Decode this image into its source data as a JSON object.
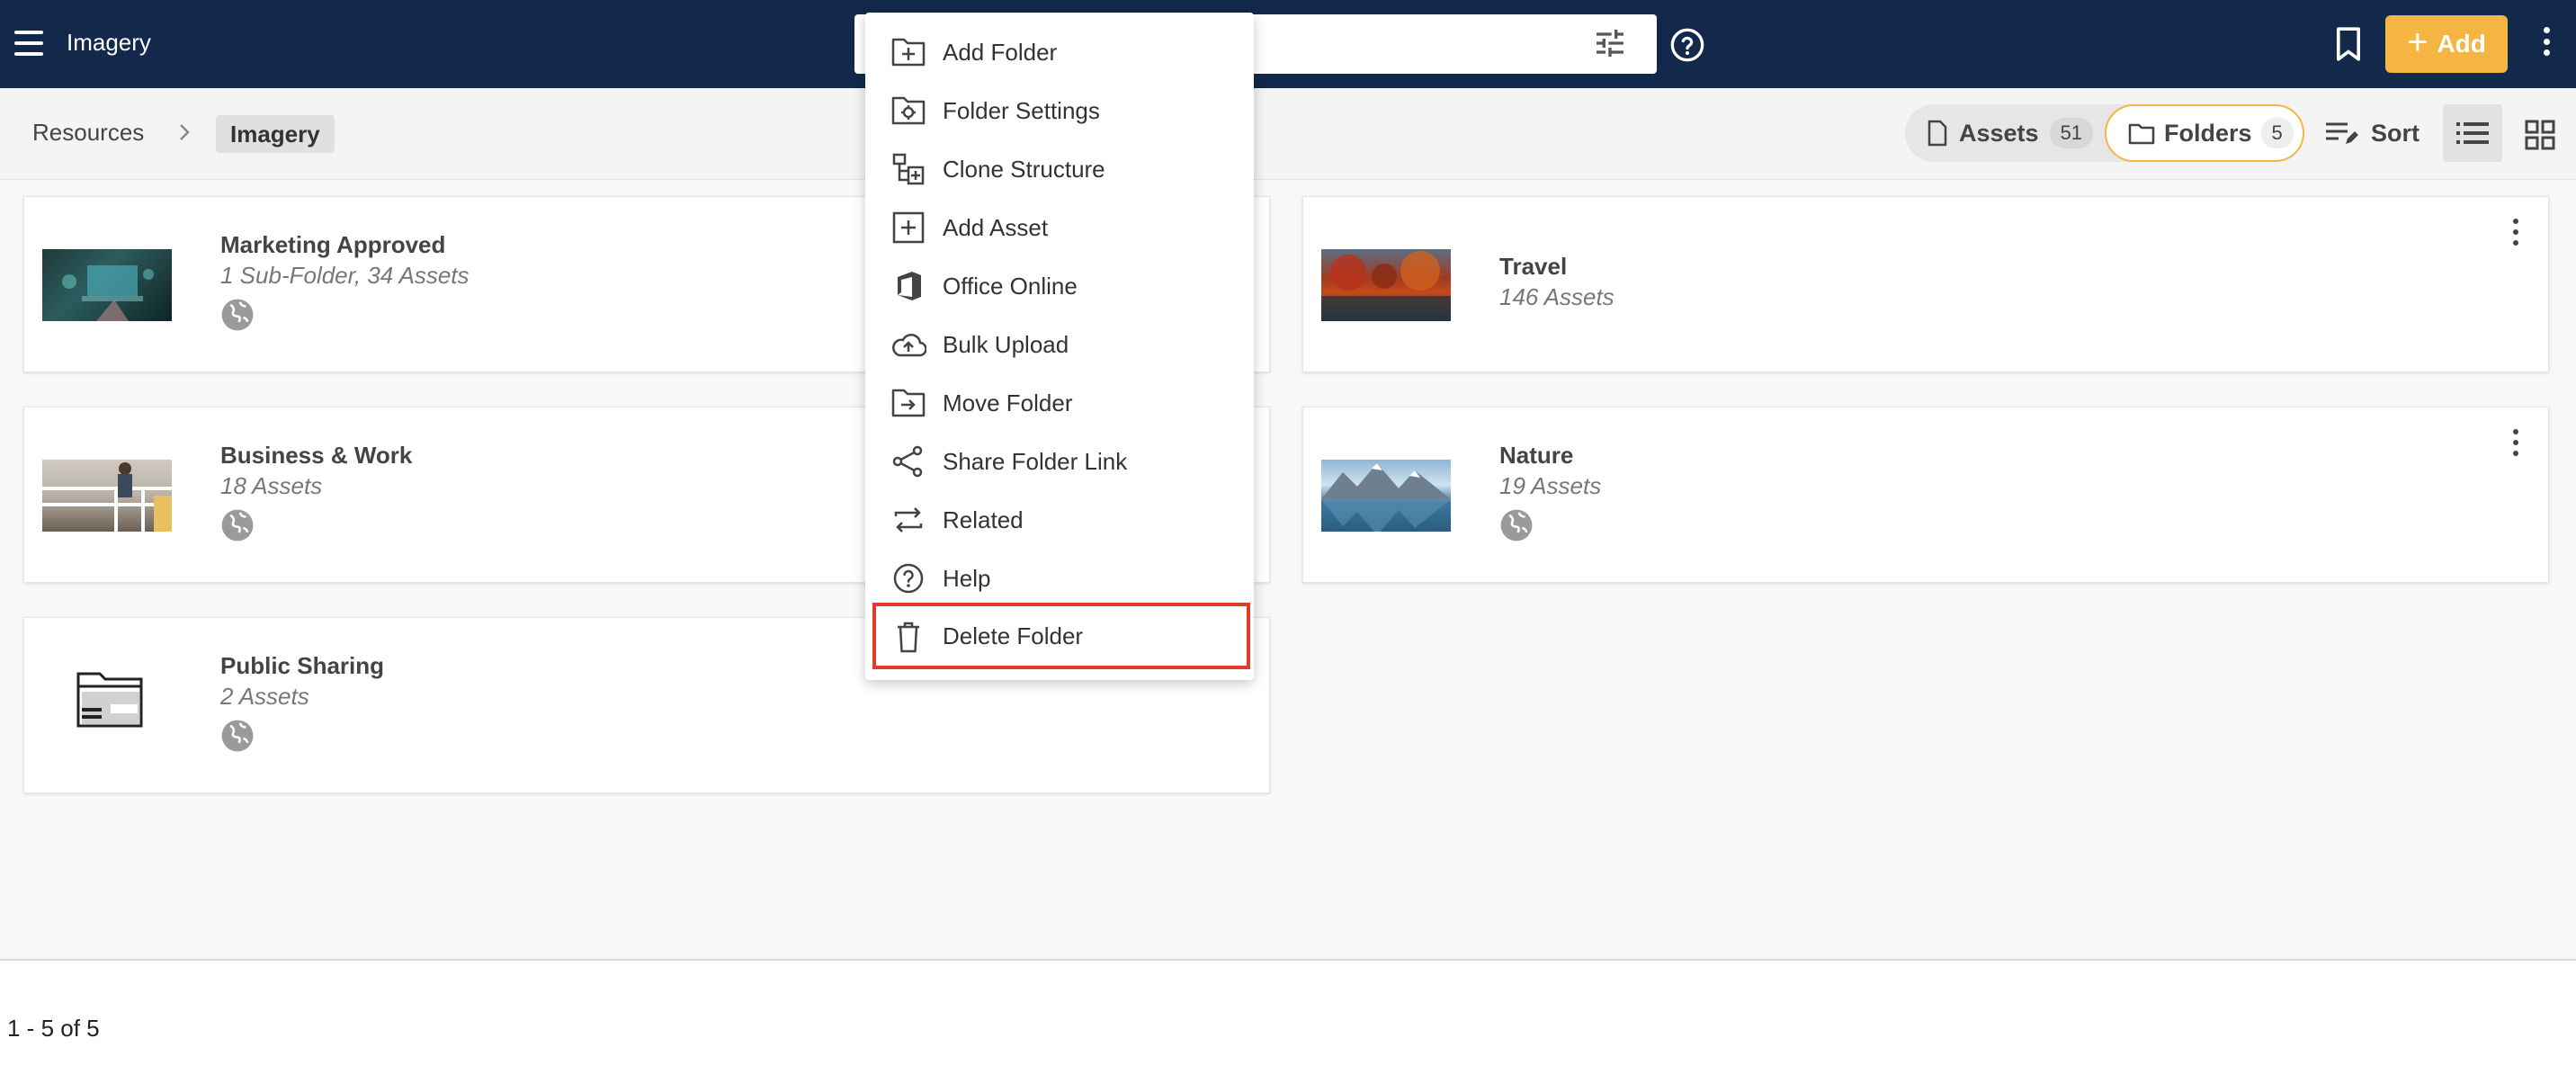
{
  "header": {
    "app_title": "Imagery",
    "add_label": "Add",
    "accent": "#f5b543",
    "bg": "#13294b"
  },
  "breadcrumb": {
    "root": "Resources",
    "current": "Imagery"
  },
  "toolbar": {
    "assets_label": "Assets",
    "assets_count": "51",
    "folders_label": "Folders",
    "folders_count": "5",
    "sort_label": "Sort"
  },
  "folders": [
    {
      "name": "Marketing Approved",
      "meta": "1 Sub-Folder, 34 Assets"
    },
    {
      "name": "Travel",
      "meta": "146 Assets"
    },
    {
      "name": "Business & Work",
      "meta": "18 Assets"
    },
    {
      "name": "Nature",
      "meta": "19 Assets"
    },
    {
      "name": "Public Sharing",
      "meta": "2 Assets"
    }
  ],
  "menu": {
    "items": [
      {
        "label": "Add Folder",
        "icon": "folder-plus-icon"
      },
      {
        "label": "Folder Settings",
        "icon": "folder-settings-icon"
      },
      {
        "label": "Clone Structure",
        "icon": "clone-structure-icon"
      },
      {
        "label": "Add Asset",
        "icon": "add-box-icon"
      },
      {
        "label": "Office Online",
        "icon": "office-icon"
      },
      {
        "label": "Bulk Upload",
        "icon": "cloud-upload-icon"
      },
      {
        "label": "Move Folder",
        "icon": "folder-move-icon"
      },
      {
        "label": "Share Folder Link",
        "icon": "share-icon"
      },
      {
        "label": "Related",
        "icon": "related-arrows-icon"
      },
      {
        "label": "Help",
        "icon": "help-icon"
      },
      {
        "label": "Delete Folder",
        "icon": "trash-icon"
      }
    ],
    "highlight_color": "#e23b2e"
  },
  "pager": {
    "text": "1 - 5 of 5"
  }
}
